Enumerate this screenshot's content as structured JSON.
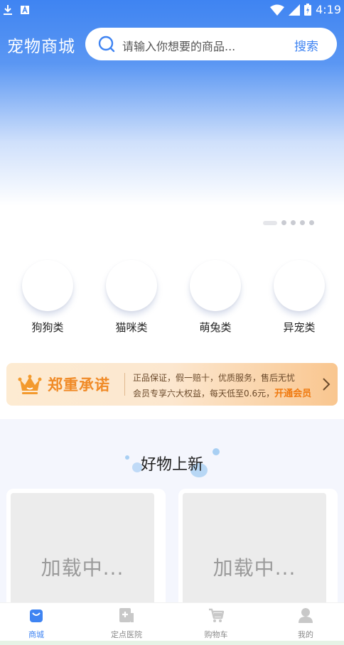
{
  "status_bar": {
    "time": "4:19",
    "icons": [
      "download-icon",
      "notification-a-icon",
      "wifi-icon",
      "signal-icon",
      "battery-icon"
    ]
  },
  "header": {
    "title": "宠物商城",
    "search": {
      "placeholder": "请输入你想要的商品...",
      "button_label": "搜索"
    }
  },
  "banner": {
    "slide_count": 5,
    "active_index": 0
  },
  "categories": [
    {
      "label": "狗狗类"
    },
    {
      "label": "猫咪类"
    },
    {
      "label": "萌兔类"
    },
    {
      "label": "异宠类"
    }
  ],
  "promise": {
    "title": "郑重承诺",
    "line1": "正品保证，假一赔十，优质服务，售后无忧",
    "line2": "会员专享六大权益，每天低至0.6元，",
    "cta": "开通会员"
  },
  "new_arrivals": {
    "title": "好物上新",
    "cards": [
      {
        "loading_text": "加载中..."
      },
      {
        "loading_text": "加载中..."
      }
    ]
  },
  "tabbar": {
    "tabs": [
      {
        "label": "商城",
        "icon": "shop-bag-icon",
        "active": true
      },
      {
        "label": "定点医院",
        "icon": "hospital-icon",
        "active": false
      },
      {
        "label": "购物车",
        "icon": "cart-icon",
        "active": false
      },
      {
        "label": "我的",
        "icon": "user-icon",
        "active": false
      }
    ]
  },
  "colors": {
    "primary": "#3f84f2",
    "promise_accent": "#f08a26",
    "inactive_tab": "#8a8a8a"
  }
}
